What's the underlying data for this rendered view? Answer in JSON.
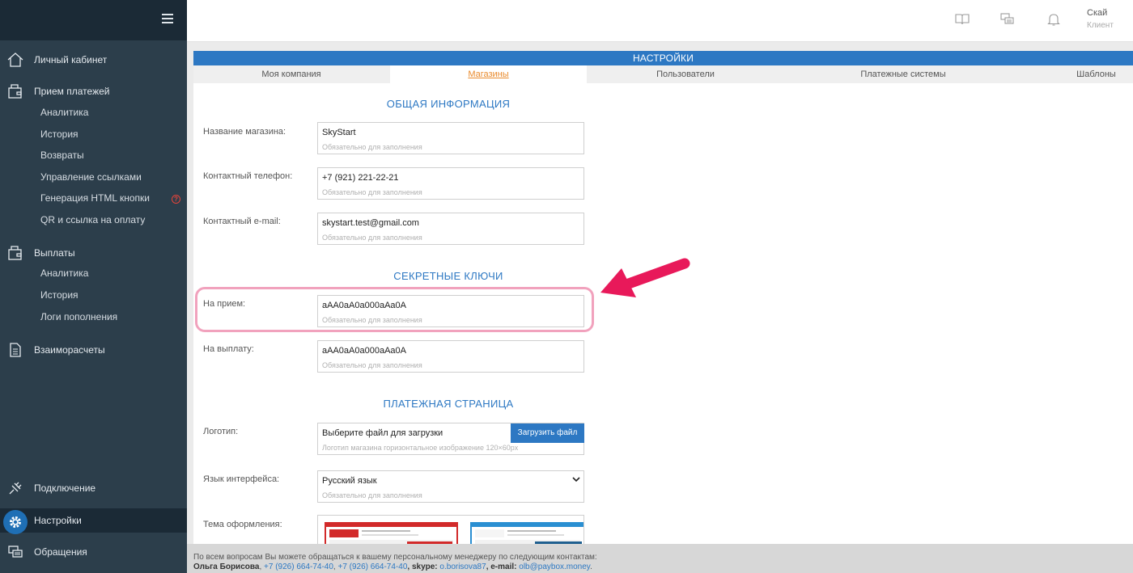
{
  "sidebar": {
    "items": [
      {
        "label": "Личный кабинет",
        "icon": "home-icon"
      },
      {
        "label": "Прием платежей",
        "icon": "wallet-icon"
      },
      {
        "label": "Выплаты",
        "icon": "wallet-icon"
      },
      {
        "label": "Взаиморасчеты",
        "icon": "document-icon"
      },
      {
        "label": "Подключение",
        "icon": "plug-icon"
      },
      {
        "label": "Настройки",
        "icon": "gear-icon"
      },
      {
        "label": "Обращения",
        "icon": "chat-icon"
      }
    ],
    "payments_sub": [
      "Аналитика",
      "История",
      "Возвраты",
      "Управление ссылками",
      "Генерация HTML кнопки",
      "QR и ссылка на оплату"
    ],
    "payouts_sub": [
      "Аналитика",
      "История",
      "Логи пополнения"
    ],
    "alert_mark": "?"
  },
  "header": {
    "user_name": "Скай",
    "user_role": "Клиент"
  },
  "panel": {
    "title": "НАСТРОЙКИ",
    "tabs": [
      "Моя компания",
      "Магазины",
      "Пользователи",
      "Платежные системы",
      "Шаблоны"
    ],
    "active_tab": "Магазины"
  },
  "sections": {
    "general": "ОБЩАЯ ИНФОРМАЦИЯ",
    "keys": "СЕКРЕТНЫЕ КЛЮЧИ",
    "payment_page": "ПЛАТЕЖНАЯ СТРАНИЦА"
  },
  "fields": {
    "shop_name": {
      "label": "Название магазина:",
      "value": "SkyStart",
      "hint": "Обязательно для заполнения"
    },
    "phone": {
      "label": "Контактный телефон:",
      "value": "+7 (921) 221-22-21",
      "hint": "Обязательно для заполнения"
    },
    "email": {
      "label": "Контактный e-mail:",
      "value": "skystart.test@gmail.com",
      "hint": "Обязательно для заполнения"
    },
    "key_in": {
      "label": "На прием:",
      "value": "aAA0aA0a000aAa0A",
      "hint": "Обязательно для заполнения"
    },
    "key_out": {
      "label": "На выплату:",
      "value": "aAA0aA0a000aAa0A",
      "hint": "Обязательно для заполнения"
    },
    "logo": {
      "label": "Логотип:",
      "value": "Выберите файл для загрузки",
      "button": "Загрузить файл",
      "hint": "Логотип магазина горизонтальное изображение 120×60px"
    },
    "language": {
      "label": "Язык интерфейса:",
      "value": "Русский язык",
      "hint": "Обязательно для заполнения"
    },
    "theme": {
      "label": "Тема оформления:"
    }
  },
  "footer": {
    "line1": "По всем вопросам Вы можете обращаться к вашему персональному менеджеру по следующим контактам:",
    "manager": "Ольга Борисова",
    "sep1": ", ",
    "phone1": "+7 (926) 664-74-40",
    "sep2": ", ",
    "phone2": "+7 (926) 664-74-40",
    "skype_label": ", skype: ",
    "skype": "o.borisova87",
    "email_label": ", e-mail: ",
    "email": "olb@paybox.money",
    "end": "."
  },
  "colors": {
    "sidebar": "#2c3e4b",
    "accent": "#2d78c3",
    "active_tab": "#e98a2c",
    "highlight": "#f1a2bd",
    "arrow": "#e8195a"
  }
}
